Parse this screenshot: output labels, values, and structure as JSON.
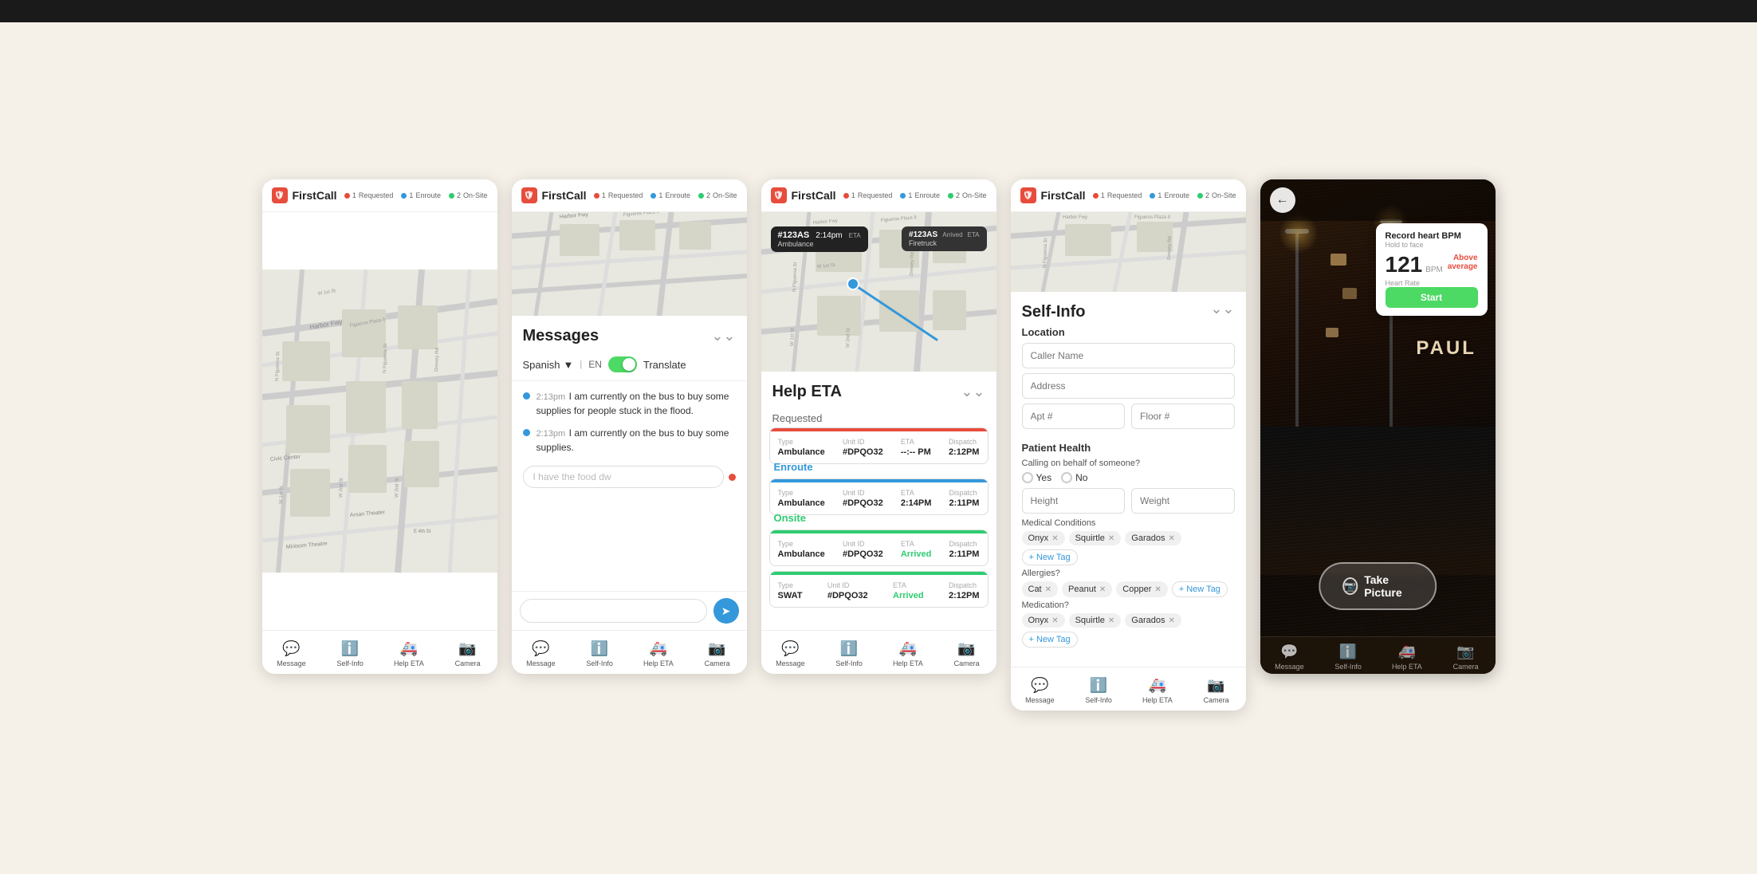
{
  "app": {
    "name": "FirstCall",
    "status": {
      "requested": {
        "count": "1",
        "label": "Requested"
      },
      "enroute": {
        "count": "1",
        "label": "Enroute"
      },
      "onsite": {
        "count": "2",
        "label": "On-Site"
      }
    }
  },
  "screens": {
    "screen1": {
      "type": "map",
      "nav": [
        "Message",
        "Self-Info",
        "Help ETA",
        "Camera"
      ]
    },
    "screen2": {
      "type": "messages",
      "title": "Messages",
      "language": "Spanish",
      "lang_code": "EN",
      "translate_label": "Translate",
      "messages": [
        {
          "time": "2:13pm",
          "text": "I am currently on the bus to buy some supplies for people stuck in the flood."
        },
        {
          "time": "2:13pm",
          "text": "I am currently on the bus to buy some supplies."
        }
      ],
      "input_placeholder": "I have the food dw",
      "nav": [
        "Message",
        "Self-Info",
        "Help ETA",
        "Camera"
      ]
    },
    "screen3": {
      "type": "help_eta",
      "title": "Help ETA",
      "popup_id": "#123AS",
      "popup_time": "2:14pm",
      "popup_eta": "ETA",
      "popup_type": "Ambulance",
      "route_sections": [
        "Requested",
        "Enroute",
        "Onsite"
      ],
      "cards": [
        {
          "status": "requested",
          "color": "red",
          "type": "Ambulance",
          "unit_id": "#DPQO32",
          "eta": "--:-- PM",
          "dispatch": "2:12PM"
        },
        {
          "status": "enroute",
          "color": "blue",
          "type": "Ambulance",
          "unit_id": "#DPQO32",
          "eta": "2:14PM",
          "dispatch": "2:11PM"
        },
        {
          "status": "onsite",
          "color": "green",
          "type": "Ambulance",
          "unit_id": "#DPQO32",
          "eta": "Arrived",
          "dispatch": "2:11PM"
        },
        {
          "status": "onsite2",
          "color": "green",
          "type": "SWAT",
          "unit_id": "#DPQO32",
          "eta": "Arrived",
          "dispatch": "2:12PM"
        }
      ],
      "arrived_popup": {
        "id": "#123AS",
        "status": "Arrived",
        "eta": "ETA",
        "type": "Firetruck"
      },
      "nav": [
        "Message",
        "Self-Info",
        "Help ETA",
        "Camera"
      ]
    },
    "screen4": {
      "type": "self_info",
      "title": "Self-Info",
      "sections": {
        "location": {
          "label": "Location",
          "caller_name_placeholder": "Caller Name",
          "address_placeholder": "Address",
          "apt_placeholder": "Apt #",
          "floor_placeholder": "Floor #"
        },
        "patient_health": {
          "label": "Patient Health",
          "behalf_label": "Calling on behalf of someone?",
          "yes": "Yes",
          "no": "No",
          "height_placeholder": "Height",
          "weight_placeholder": "Weight",
          "medical_label": "Medical Conditions",
          "medical_tags": [
            "Onyx",
            "Squirtle",
            "Garados"
          ],
          "allergies_label": "Allergies?",
          "allergy_tags": [
            "Cat",
            "Peanut",
            "Copper"
          ],
          "medication_label": "Medication?",
          "medication_tags": [
            "Onyx",
            "Squirtle",
            "Garados"
          ],
          "new_tag": "+ New Tag"
        }
      },
      "nav": [
        "Message",
        "Self-Info",
        "Help ETA",
        "Camera"
      ]
    },
    "screen5": {
      "type": "camera",
      "heart_bpm": {
        "title": "Record heart BPM",
        "subtitle": "Hold to face",
        "bpm_value": "121",
        "bpm_unit": "BPM",
        "bpm_label": "Heart Rate",
        "status": "Above average",
        "start_label": "Start"
      },
      "sign_text": "PAUL",
      "take_picture_label": "Take Picture",
      "nav": [
        "Message",
        "Self-Info",
        "Help ETA",
        "Camera"
      ]
    }
  }
}
